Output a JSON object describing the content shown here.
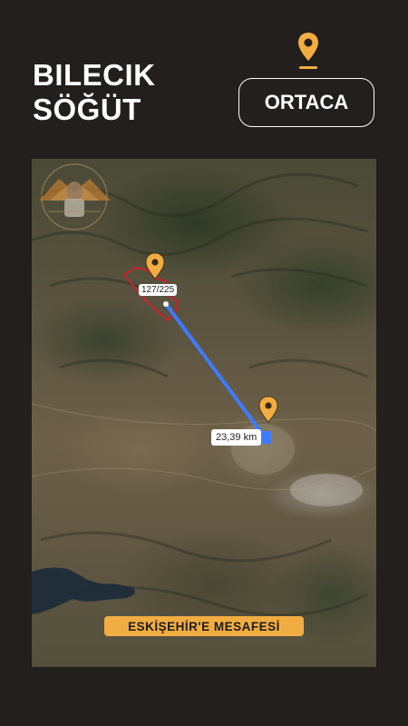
{
  "header": {
    "line1": "BILECIK",
    "line2": "SÖĞÜT"
  },
  "district_button": "ORTACA",
  "map": {
    "parcel_label": "127/225",
    "distance_label": "23,39 km",
    "banner": "ESKİŞEHİR'E MESAFESİ"
  },
  "colors": {
    "background": "#231f1c",
    "accent": "#f2ad42",
    "route": "#3d7bff",
    "parcel_outline": "#e0192a"
  }
}
